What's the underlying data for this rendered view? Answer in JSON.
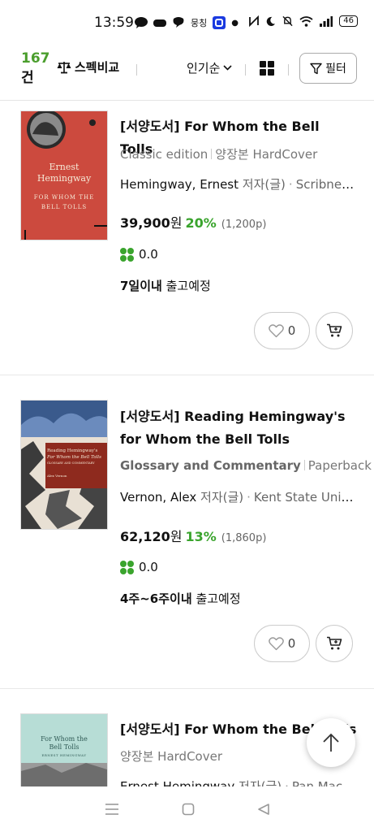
{
  "status_bar": {
    "time": "13:59",
    "notif_text": "뭉칭",
    "battery": "46"
  },
  "toolbar": {
    "count_num": "167",
    "count_unit": "건",
    "compare_label": "스펙비교",
    "sort_label": "인기순",
    "filter_label": "필터"
  },
  "items": [
    {
      "title": "[서양도서] For Whom the Bell Tolls",
      "subtitle_a": "Classic edition",
      "subtitle_b": "양장본 HardCover",
      "author": "Hemingway, Ernest",
      "role": "저자(글)",
      "publisher": "Scribner...",
      "price": "39,900",
      "won": "원",
      "discount": "20%",
      "points": "(1,200p)",
      "rating": "0.0",
      "ship_bold": "7일이내",
      "ship_text": "출고예정",
      "likes": "0",
      "cover": {
        "line1": "Ernest",
        "line2": "Hemingway",
        "line3": "FOR WHOM THE",
        "line4": "BELL TOLLS"
      }
    },
    {
      "title": "[서양도서] Reading Hemingway's for Whom the Bell Tolls",
      "subtitle_a": "Glossary and Commentary",
      "subtitle_b": "Paperback",
      "author": "Vernon, Alex",
      "role": "저자(글)",
      "publisher": "Kent State Univ...",
      "price": "62,120",
      "won": "원",
      "discount": "13%",
      "points": "(1,860p)",
      "rating": "0.0",
      "ship_bold": "4주~6주이내",
      "ship_text": "출고예정",
      "likes": "0",
      "cover": {
        "line1": "Reading Hemingway's",
        "line2": "For Whom the Bell Tolls",
        "line3": "GLOSSARY AND COMMENTARY",
        "line4": "Alex Vernon"
      }
    },
    {
      "title": "[서양도서] For Whom the Bell Tolls",
      "subtitle_b": "양장본 HardCover",
      "author": "Ernest Hemingway",
      "role": "저자(글)",
      "publisher": "Pan Mac...",
      "cover": {
        "line1": "For Whom the",
        "line2": "Bell Tolls",
        "line3": "ERNEST HEMINGWAY"
      }
    }
  ]
}
